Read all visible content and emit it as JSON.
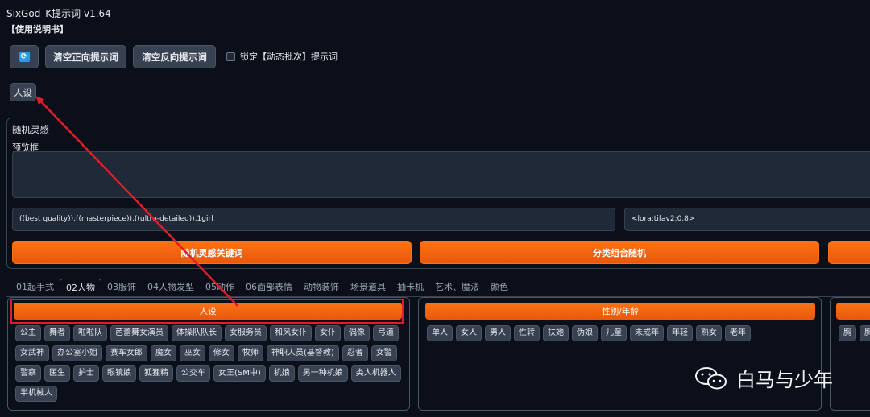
{
  "app": {
    "title": "SixGod_K提示词 v1.64",
    "manual_link": "【使用说明书】"
  },
  "toolbar": {
    "refresh_icon": "refresh-icon",
    "clear_positive": "清空正向提示词",
    "clear_negative": "清空反向提示词",
    "lock_label": "锁定【动态批次】提示词"
  },
  "persona_button": "人设",
  "inspiration": {
    "title": "随机灵感",
    "preview_label": "预览框",
    "preview_value": "",
    "prompt_value": "((best quality)),((masterpiece)),((ultra-detailed)),1girl",
    "lora_value": "<lora:tifav2:0.8>",
    "keyword_button": "随机灵感关键词",
    "combo_button": "分类组合随机",
    "extra_button": ""
  },
  "tabs": [
    "01起手式",
    "02人物",
    "03服饰",
    "04人物发型",
    "05动作",
    "06面部表情",
    "动物装饰",
    "场景道具",
    "抽卡机",
    "艺术、魔法",
    "颜色"
  ],
  "active_tab": "02人物",
  "categories": {
    "persona": {
      "title": "人设",
      "tags": [
        "公主",
        "舞者",
        "啦啦队",
        "芭蕾舞女演员",
        "体操队队长",
        "女服务员",
        "和风女仆",
        "女仆",
        "偶像",
        "弓道",
        "女武神",
        "办公室小姐",
        "赛车女郎",
        "魔女",
        "巫女",
        "修女",
        "牧师",
        "神职人员(基督教)",
        "忍者",
        "女警",
        "警察",
        "医生",
        "护士",
        "眼镜娘",
        "狐狸精",
        "公交车",
        "女王(SM中)",
        "机娘",
        "另一种机娘",
        "类人机器人",
        "半机械人"
      ]
    },
    "gender_age": {
      "title": "性别/年龄",
      "tags": [
        "单人",
        "女人",
        "男人",
        "性转",
        "扶她",
        "伪娘",
        "儿童",
        "未成年",
        "年轻",
        "熟女",
        "老年"
      ]
    },
    "third": {
      "title": "",
      "tags": [
        "胸",
        "胸"
      ]
    }
  },
  "watermark": {
    "text": "白马与少年",
    "icon": "wechat-icon"
  },
  "colors": {
    "accent": "#f97316",
    "annotation": "#e11d2a",
    "background": "#0b0f19"
  }
}
